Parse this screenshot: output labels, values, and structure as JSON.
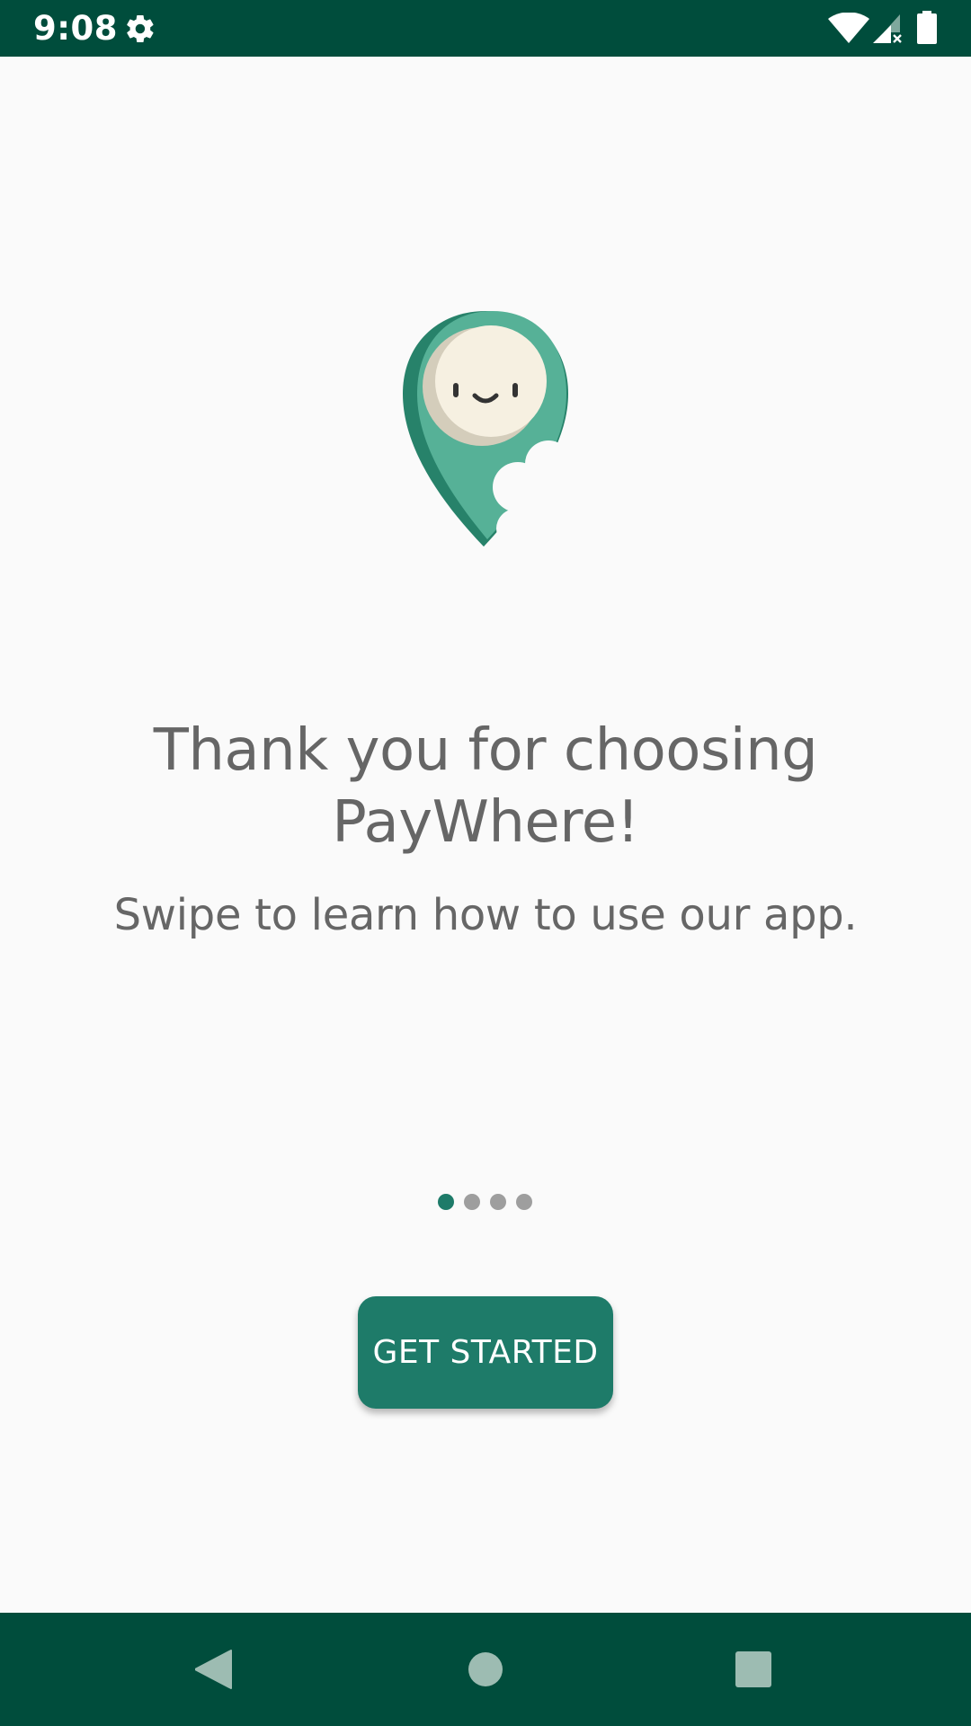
{
  "status_bar": {
    "time": "9:08",
    "background": "#004d3c",
    "icons": [
      "gear-icon",
      "wifi-icon",
      "signal-icon",
      "battery-icon"
    ]
  },
  "logo": {
    "icon": "paywhere-pin-logo",
    "colors": {
      "pin": "#56b197",
      "pin_shadow": "#27826a",
      "face": "#f6f0e1"
    }
  },
  "onboarding": {
    "headline": "Thank you for choosing PayWhere!",
    "subheadline": "Swipe to learn how to use our app.",
    "pager": {
      "total_pages": 4,
      "current_page": 1,
      "active_color": "#1e7b69",
      "inactive_color": "#9e9e9e"
    },
    "button_label": "GET STARTED",
    "accent": "#1e7b69"
  },
  "nav_bar": {
    "background": "#004d3c",
    "icons": [
      "back-icon",
      "home-icon",
      "recents-icon"
    ]
  }
}
